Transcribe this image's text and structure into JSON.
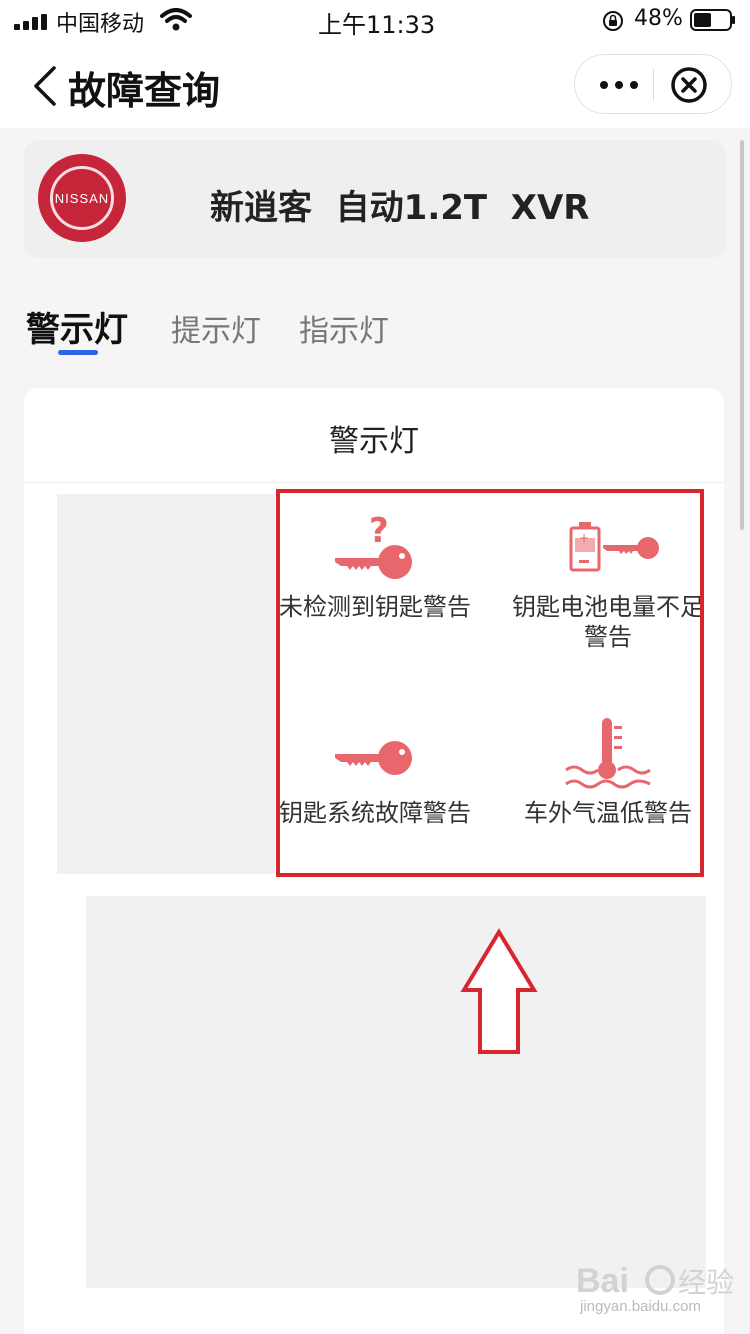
{
  "status_bar": {
    "carrier": "中国移动",
    "time": "上午11:33",
    "battery_pct": "48%"
  },
  "nav": {
    "title": "故障查询",
    "icons": [
      "chevron-left-icon",
      "more-icon",
      "close-circle-icon"
    ]
  },
  "car": {
    "logo_text": "NISSAN",
    "name": "新逍客  自动1.2T  XVR"
  },
  "tabs": [
    {
      "label": "警示灯",
      "active": true
    },
    {
      "label": "提示灯",
      "active": false
    },
    {
      "label": "指示灯",
      "active": false
    }
  ],
  "panel": {
    "title": "警示灯",
    "items": [
      {
        "label": "未检测到钥匙警告",
        "icon": "key-question-icon"
      },
      {
        "label": "钥匙电池电量不足警告",
        "icon": "key-battery-icon"
      },
      {
        "label": "钥匙系统故障警告",
        "icon": "key-icon"
      },
      {
        "label": "车外气温低警告",
        "icon": "thermometer-icon"
      }
    ]
  },
  "annotation": {
    "box_color": "#d8262e",
    "arrow_color": "#d8262e"
  },
  "colors": {
    "accent": "#2f63e8",
    "icon": "#e8676c",
    "brand": "#c6253a"
  },
  "watermark": {
    "text": "jingyan.baidu.com"
  }
}
